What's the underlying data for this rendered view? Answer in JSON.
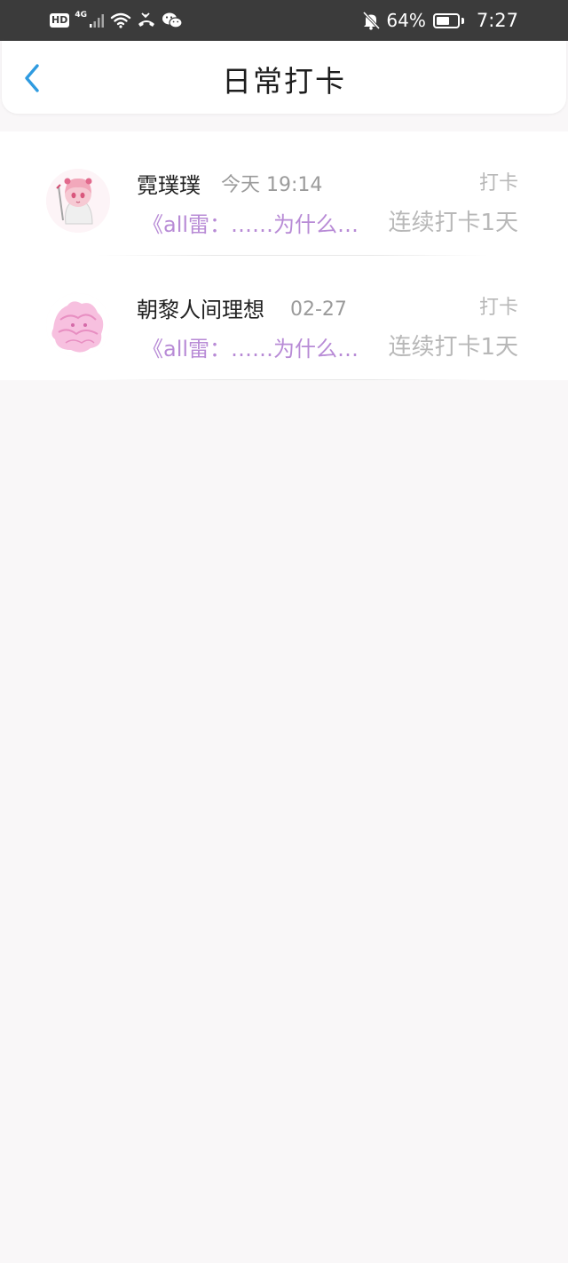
{
  "status_bar": {
    "hd_badge": "HD",
    "network": "4G",
    "battery_percent": "64%",
    "battery_level": 0.64,
    "time": "7:27",
    "icons": [
      "hd-icon",
      "signal-icon",
      "wifi-icon",
      "missed-call-icon",
      "wechat-icon",
      "bell-off-icon",
      "battery-icon"
    ]
  },
  "header": {
    "back_icon": "chevron-left-icon",
    "title": "日常打卡",
    "accent_color": "#2f9be0"
  },
  "list": {
    "items": [
      {
        "name": "霓璞璞",
        "time": "今天 19:14",
        "action": "打卡",
        "preview": "《all雷：……为什么…",
        "streak": "连续打卡1天",
        "avatar": "avatar-anime-girl"
      },
      {
        "name": "朝黎人间理想",
        "time": "02-27",
        "action": "打卡",
        "preview": "《all雷：……为什么…",
        "streak": "连续打卡1天",
        "avatar": "avatar-pink-sketch"
      }
    ]
  },
  "colors": {
    "preview_text": "#b88bd6",
    "muted_text": "#b8b8b8",
    "page_background": "#f9f7f8"
  }
}
